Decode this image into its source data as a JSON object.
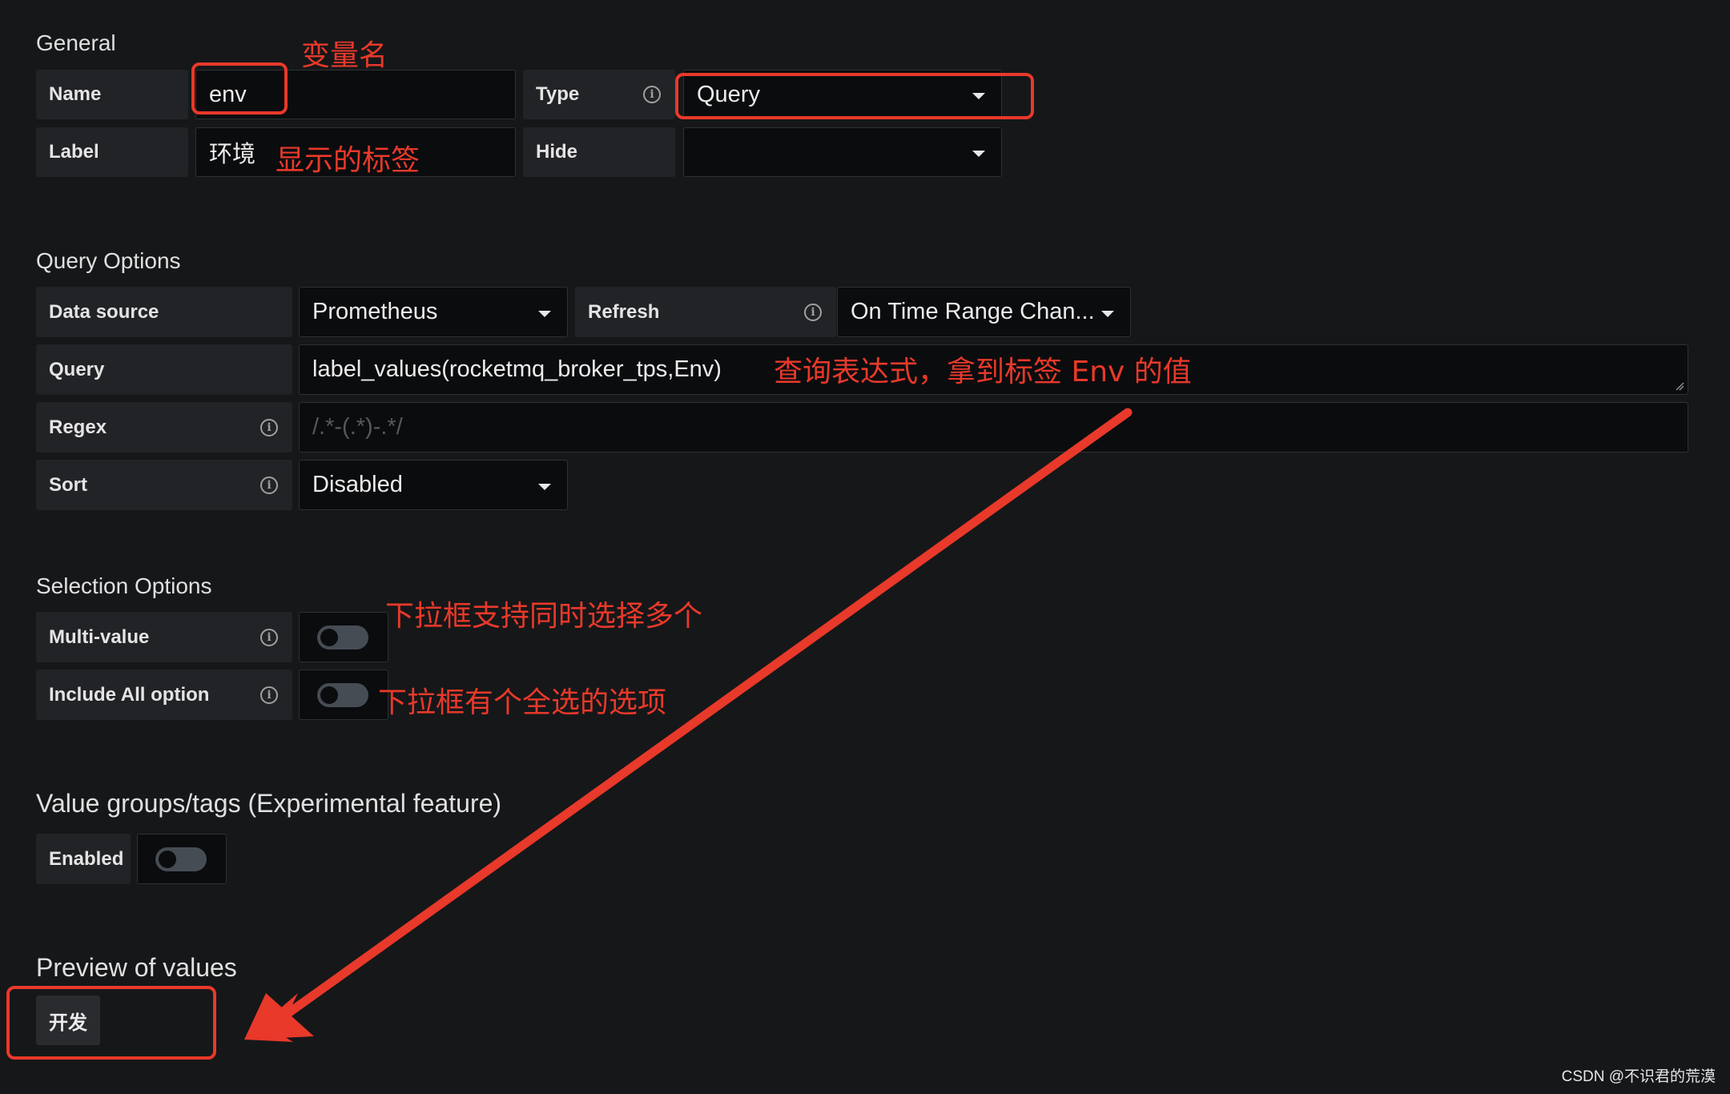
{
  "general": {
    "title": "General",
    "name_label": "Name",
    "name_value": "env",
    "type_label": "Type",
    "type_value": "Query",
    "label_label": "Label",
    "label_value": "环境",
    "hide_label": "Hide",
    "hide_value": ""
  },
  "query_options": {
    "title": "Query Options",
    "datasource_label": "Data source",
    "datasource_value": "Prometheus",
    "refresh_label": "Refresh",
    "refresh_value": "On Time Range Chan...",
    "query_label": "Query",
    "query_value": "label_values(rocketmq_broker_tps,Env)",
    "regex_label": "Regex",
    "regex_placeholder": "/.*-(.*)-.*/",
    "sort_label": "Sort",
    "sort_value": "Disabled"
  },
  "selection_options": {
    "title": "Selection Options",
    "multi_label": "Multi-value",
    "include_all_label": "Include All option"
  },
  "value_groups": {
    "title": "Value groups/tags (Experimental feature)",
    "enabled_label": "Enabled"
  },
  "preview": {
    "title": "Preview of values",
    "values": [
      "开发"
    ]
  },
  "annotations": {
    "var_name": "变量名",
    "display_label": "显示的标签",
    "query_expr": "查询表达式，拿到标签 Env 的值",
    "multi": "下拉框支持同时选择多个",
    "include_all": "下拉框有个全选的选项"
  },
  "watermark": "CSDN @不识君的荒漠",
  "colors": {
    "background": "#161719",
    "annotation_red": "#e8392a"
  }
}
